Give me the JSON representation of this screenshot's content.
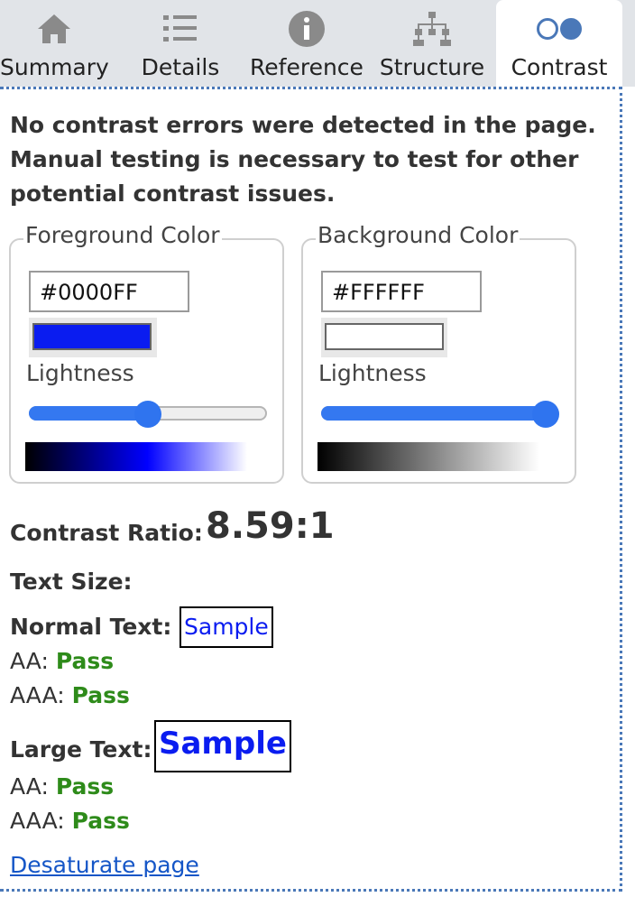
{
  "tabs": [
    {
      "label": "Summary",
      "icon": "home-icon"
    },
    {
      "label": "Details",
      "icon": "list-icon"
    },
    {
      "label": "Reference",
      "icon": "info-icon"
    },
    {
      "label": "Structure",
      "icon": "hierarchy-icon"
    },
    {
      "label": "Contrast",
      "icon": "contrast-icon",
      "active": true
    }
  ],
  "message": "No contrast errors were detected in the page. Manual testing is necessary to test for other potential contrast issues.",
  "foreground": {
    "legend": "Foreground Color",
    "hex": "#0000FF",
    "lightness_label": "Lightness",
    "lightness": 0.5
  },
  "background": {
    "legend": "Background Color",
    "hex": "#FFFFFF",
    "lightness_label": "Lightness",
    "lightness": 1.0
  },
  "contrast": {
    "label": "Contrast Ratio:",
    "value": "8.59:1"
  },
  "text_size_label": "Text Size:",
  "normal_text": {
    "label": "Normal Text:",
    "sample": "Sample",
    "aa_label": "AA:",
    "aa": "Pass",
    "aaa_label": "AAA:",
    "aaa": "Pass"
  },
  "large_text": {
    "label": "Large Text:",
    "sample": "Sample",
    "aa_label": "AA:",
    "aa": "Pass",
    "aaa_label": "AAA:",
    "aaa": "Pass"
  },
  "desaturate_link": "Desaturate page",
  "colors": {
    "accent": "#3478F0",
    "pass": "#2E8B1A",
    "sample_fg": "#0000FF",
    "tab_bar": "#E1E4E8"
  }
}
